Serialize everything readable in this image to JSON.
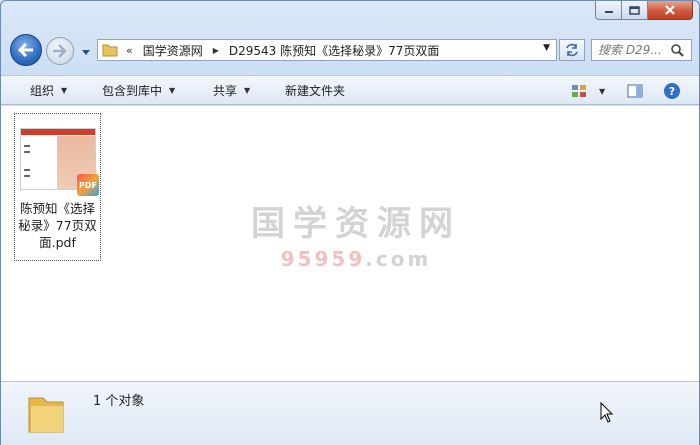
{
  "address": {
    "chevrons": "«",
    "segments": [
      "国学资源网",
      "D29543 陈预知《选择秘录》77页双面"
    ]
  },
  "search": {
    "placeholder": "搜索 D29..."
  },
  "toolbar": {
    "organize": "组织",
    "include_in_library": "包含到库中",
    "share": "共享",
    "new_folder": "新建文件夹"
  },
  "watermark": {
    "title": "国学资源网",
    "url_red": "95959",
    "url_rest": ".com"
  },
  "files": [
    {
      "name_lines": [
        "陈预知《选择",
        "秘录》77页双",
        "面.pdf"
      ],
      "badge": "PDF"
    }
  ],
  "status": {
    "item_count": "1 个对象"
  },
  "colors": {
    "accent": "#2d6cc0",
    "window_frame": "#cddff3",
    "close_button": "#c13f22"
  }
}
